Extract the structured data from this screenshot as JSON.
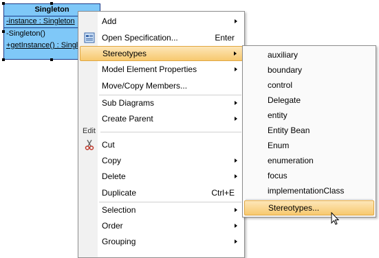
{
  "diagram": {
    "class_name": "Singleton",
    "attribute": "-instance : Singleton",
    "operations": [
      "-Singleton()",
      "+getInstance() : Singleton"
    ]
  },
  "context_menu": {
    "items": {
      "add": "Add",
      "open_spec": "Open Specification...",
      "open_spec_shortcut": "Enter",
      "stereotypes": "Stereotypes",
      "model_element_props": "Model Element Properties",
      "move_copy": "Move/Copy Members...",
      "sub_diagrams": "Sub Diagrams",
      "create_parent": "Create Parent",
      "edit_group": "Edit",
      "cut": "Cut",
      "copy": "Copy",
      "delete": "Delete",
      "duplicate": "Duplicate",
      "duplicate_shortcut": "Ctrl+E",
      "selection": "Selection",
      "order": "Order",
      "grouping": "Grouping"
    }
  },
  "stereotypes_submenu": {
    "items": [
      "auxiliary",
      "boundary",
      "control",
      "Delegate",
      "entity",
      "Entity Bean",
      "Enum",
      "enumeration",
      "focus",
      "implementationClass"
    ],
    "more": "Stereotypes..."
  },
  "colors": {
    "class_fill": "#7fc8f8",
    "highlight": "#f7c96f"
  }
}
